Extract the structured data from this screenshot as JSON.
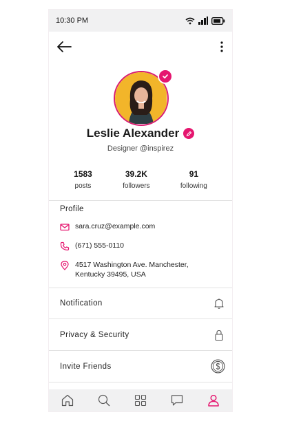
{
  "status_bar": {
    "time": "10:30 PM"
  },
  "profile": {
    "name": "Leslie Alexander",
    "handle": "Designer @inspirez"
  },
  "stats": [
    {
      "value": "1583",
      "label": "posts"
    },
    {
      "value": "39.2K",
      "label": "followers"
    },
    {
      "value": "91",
      "label": "following"
    }
  ],
  "section": {
    "title": "Profile"
  },
  "contact": {
    "email": "sara.cruz@example.com",
    "phone": "(671) 555-0110",
    "address": "4517 Washington Ave. Manchester, Kentucky 39495, USA"
  },
  "menu": [
    {
      "label": "Notification",
      "icon": "bell-icon"
    },
    {
      "label": "Privacy & Security",
      "icon": "lock-icon"
    },
    {
      "label": "Invite Friends",
      "icon": "dollar-coin-icon"
    }
  ],
  "nav": [
    "home-icon",
    "search-icon",
    "grid-icon",
    "chat-icon",
    "profile-icon"
  ],
  "colors": {
    "accent": "#e5166f",
    "status_bg": "#f1f1f2",
    "divider": "#e2e2e2"
  }
}
